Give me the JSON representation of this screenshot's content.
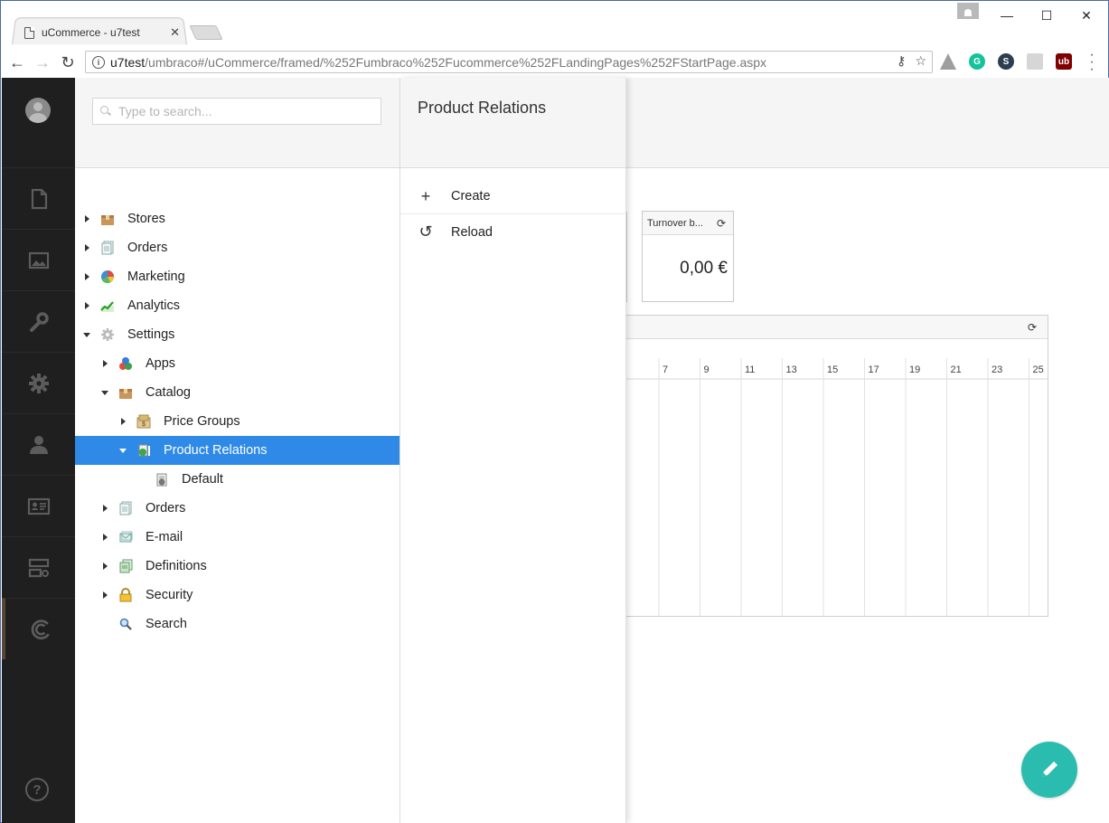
{
  "browser": {
    "tab_title": "uCommerce - u7test",
    "tab_close": "✕",
    "url_host": "u7test",
    "url_path": "/umbraco#/uCommerce/framed/%252Fumbraco%252Fucommerce%252FLandingPages%252FStartPage.aspx",
    "window_controls": {
      "minimize": "—",
      "maximize": "☐",
      "close": "✕"
    }
  },
  "sections": [
    {
      "name": "content",
      "icon": "document-icon"
    },
    {
      "name": "media",
      "icon": "image-icon"
    },
    {
      "name": "settings",
      "icon": "wrench-icon"
    },
    {
      "name": "developer",
      "icon": "gear-icon"
    },
    {
      "name": "users",
      "icon": "user-icon"
    },
    {
      "name": "members",
      "icon": "id-card-icon"
    },
    {
      "name": "forms",
      "icon": "forms-icon"
    },
    {
      "name": "ucommerce",
      "icon": "ucommerce-icon",
      "active": true
    }
  ],
  "search": {
    "placeholder": "Type to search..."
  },
  "tree": {
    "nodes": [
      {
        "label": "Stores",
        "indent": 0,
        "caret": "right",
        "icon": "box-icon"
      },
      {
        "label": "Orders",
        "indent": 0,
        "caret": "right",
        "icon": "documents-icon"
      },
      {
        "label": "Marketing",
        "indent": 0,
        "caret": "right",
        "icon": "pie-chart-icon"
      },
      {
        "label": "Analytics",
        "indent": 0,
        "caret": "right",
        "icon": "line-chart-icon"
      },
      {
        "label": "Settings",
        "indent": 0,
        "caret": "down",
        "icon": "cog-icon"
      },
      {
        "label": "Apps",
        "indent": 1,
        "caret": "right",
        "icon": "apps-icon"
      },
      {
        "label": "Catalog",
        "indent": 1,
        "caret": "down",
        "icon": "box-icon"
      },
      {
        "label": "Price Groups",
        "indent": 2,
        "caret": "right",
        "icon": "price-icon"
      },
      {
        "label": "Product Relations",
        "indent": 2,
        "caret": "down",
        "icon": "relations-icon",
        "selected": true
      },
      {
        "label": "Default",
        "indent": 3,
        "caret": "none",
        "icon": "relation-type-icon"
      },
      {
        "label": "Orders",
        "indent": 1,
        "caret": "right",
        "icon": "documents-icon"
      },
      {
        "label": "E-mail",
        "indent": 1,
        "caret": "right",
        "icon": "email-icon"
      },
      {
        "label": "Definitions",
        "indent": 1,
        "caret": "right",
        "icon": "definitions-icon"
      },
      {
        "label": "Security",
        "indent": 1,
        "caret": "right",
        "icon": "lock-icon"
      },
      {
        "label": "Search",
        "indent": 1,
        "caret": "none",
        "icon": "magnifier-icon"
      }
    ]
  },
  "context_menu": {
    "title": "Product Relations",
    "items": [
      {
        "label": "Create",
        "icon": "plus-icon",
        "glyph": "+"
      },
      {
        "label": "Reload",
        "icon": "reload-icon",
        "glyph": "↺"
      }
    ]
  },
  "widget": {
    "title": "Turnover b...",
    "value": "0,00 €"
  },
  "chart": {
    "ticks": [
      "7",
      "9",
      "11",
      "13",
      "15",
      "17",
      "19",
      "21",
      "23",
      "25"
    ]
  },
  "colors": {
    "selected": "#2e8ae6",
    "fab": "#2bbcb0",
    "sections_bg": "#1f1f1f"
  }
}
